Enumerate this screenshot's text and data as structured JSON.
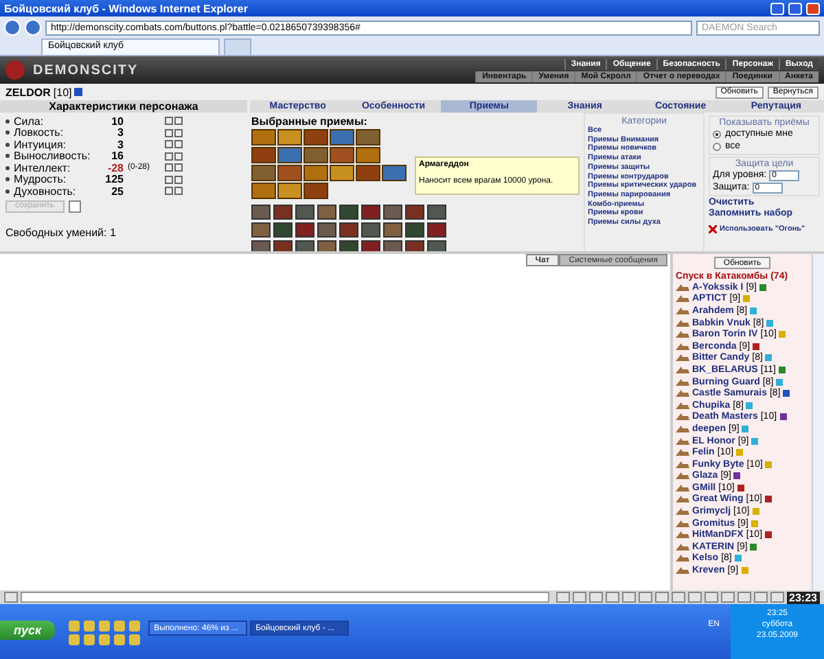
{
  "window": {
    "title": "Бойцовский клуб - Windows Internet Explorer"
  },
  "address_bar": {
    "url": "http://demonscity.combats.com/buttons.pl?battle=0.0218650739398356#",
    "search_placeholder": "DAEMON Search"
  },
  "browser_tabs": [
    {
      "label": "Бойцовский клуб",
      "selected": true
    }
  ],
  "game_header": {
    "logo": "DEMONSCITY",
    "top_menu": [
      "Знания",
      "Общение",
      "Безопасность",
      "Персонаж",
      "Выход"
    ],
    "sub_menu": [
      "Инвентарь",
      "Умения",
      "Мой Скролл",
      "Отчет о переводах",
      "Поединки",
      "Анкета"
    ]
  },
  "character": {
    "name": "ZELDOR",
    "level": "[10]"
  },
  "top_buttons": [
    "Обновить",
    "Вернуться"
  ],
  "stats_title": "Характеристики персонажа",
  "stats": [
    {
      "label": "Сила:",
      "value": "10",
      "warning": false
    },
    {
      "label": "Ловкость:",
      "value": "3",
      "warning": false
    },
    {
      "label": "Интуиция:",
      "value": "3",
      "warning": false
    },
    {
      "label": "Выносливость:",
      "value": "16",
      "warning": false
    },
    {
      "label": "Интеллект:",
      "value": "-28",
      "range": "(0-28)",
      "warning": true
    },
    {
      "label": "Мудрость:",
      "value": "125",
      "warning": false
    },
    {
      "label": "Духовность:",
      "value": "25",
      "warning": false
    }
  ],
  "save_button": {
    "label": "сохранить",
    "disabled": true
  },
  "save_checkbox": {
    "checked": false
  },
  "free_skills": "Свободных умений: 1",
  "tabs": [
    {
      "label": "Мастерство",
      "selected": false
    },
    {
      "label": "Особенности",
      "selected": false
    },
    {
      "label": "Приемы",
      "selected": true
    },
    {
      "label": "Знания",
      "selected": false
    },
    {
      "label": "Состояние",
      "selected": false
    },
    {
      "label": "Репутация",
      "selected": false
    }
  ],
  "selected_skills_title": "Выбранные приемы:",
  "tooltip": {
    "title": "Армагеддон",
    "text": "Наносит всем врагам 10000 урона."
  },
  "categories": {
    "title": "Категории",
    "items": [
      "Все",
      "Приемы Внимания",
      "Приемы новичков",
      "Приемы атаки",
      "Приемы защиты",
      "Приемы контрударов",
      "Приемы критических ударов",
      "Приемы парирования",
      "Комбо-приемы",
      "Приемы крови",
      "Приемы силы духа"
    ]
  },
  "show_skills": {
    "title": "Показывать приёмы",
    "options": [
      {
        "label": "доступные мне",
        "selected": true
      },
      {
        "label": "все",
        "selected": false
      }
    ]
  },
  "target_defense": {
    "title": "Защита цели",
    "level_label": "Для уровня:",
    "level_value": "0",
    "defense_label": "Защита:",
    "defense_value": "0"
  },
  "actions": [
    "Очистить",
    "Запомнить набор"
  ],
  "use_fire": "Использовать \"Огонь\"",
  "chat_tabs": [
    {
      "label": "Чат",
      "selected": true
    },
    {
      "label": "Системные сообщения",
      "selected": false
    }
  ],
  "players_panel": {
    "refresh": "Обновить",
    "location": "Спуск в Катакомбы (74)",
    "players": [
      {
        "name": "A-Yokssik I",
        "level": "[9]",
        "color": "#2a8a2a"
      },
      {
        "name": "APTICT",
        "level": "[9]",
        "color": "#d8b000"
      },
      {
        "name": "Arahdem",
        "level": "[8]",
        "color": "#30b0d8"
      },
      {
        "name": "Babkin Vnuk",
        "level": "[8]",
        "color": "#30b0d8"
      },
      {
        "name": "Baron Torin IV",
        "level": "[10]",
        "color": "#d8b000"
      },
      {
        "name": "Berconda",
        "level": "[9]",
        "color": "#b02020"
      },
      {
        "name": "Bitter Candy",
        "level": "[8]",
        "color": "#30b0d8"
      },
      {
        "name": "BK_BELARUS",
        "level": "[11]",
        "color": "#2a8a2a"
      },
      {
        "name": "Burning Guard",
        "level": "[8]",
        "color": "#30b0d8"
      },
      {
        "name": "Castle Samurais",
        "level": "[8]",
        "color": "#2050c0"
      },
      {
        "name": "Chupika",
        "level": "[8]",
        "color": "#30b0d8"
      },
      {
        "name": "Death Masters",
        "level": "[10]",
        "color": "#7030a0"
      },
      {
        "name": "deepen",
        "level": "[9]",
        "color": "#30b0d8"
      },
      {
        "name": "EL Honor",
        "level": "[9]",
        "color": "#30b0d8"
      },
      {
        "name": "Felin",
        "level": "[10]",
        "color": "#d8b000"
      },
      {
        "name": "Funky Byte",
        "level": "[10]",
        "color": "#d8b000"
      },
      {
        "name": "Glaza",
        "level": "[9]",
        "color": "#7030a0"
      },
      {
        "name": "GMill",
        "level": "[10]",
        "color": "#b02020"
      },
      {
        "name": "Great Wing",
        "level": "[10]",
        "color": "#b02020"
      },
      {
        "name": "Grimyclj",
        "level": "[10]",
        "color": "#d8b000"
      },
      {
        "name": "Gromitus",
        "level": "[9]",
        "color": "#d8b000"
      },
      {
        "name": "HitManDFX",
        "level": "[10]",
        "color": "#b02020"
      },
      {
        "name": "KATERIN",
        "level": "[9]",
        "color": "#2a8a2a"
      },
      {
        "name": "Kelso",
        "level": "[8]",
        "color": "#30b0d8"
      },
      {
        "name": "Kreven",
        "level": "[9]",
        "color": "#d8b000"
      }
    ]
  },
  "chat_clock": "23:23",
  "taskbar": {
    "start": "пуск",
    "tasks": [
      {
        "label": "Выполнено: 46% из ...",
        "selected": false
      },
      {
        "label": "Бойцовский клуб - ...",
        "selected": true
      }
    ],
    "language": "EN",
    "time": "23:25",
    "day": "суббота",
    "date": "23.05.2009"
  }
}
